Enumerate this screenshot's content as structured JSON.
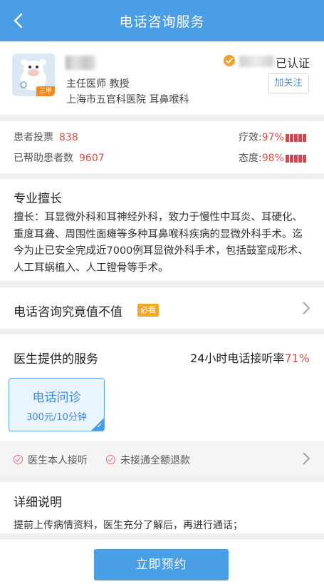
{
  "nav": {
    "title": "电话咨询服务"
  },
  "doctor": {
    "avatar_badge": "三甲",
    "title": "主任医师 教授",
    "hospital": "上海市五官科医院  耳鼻喉科",
    "verified_text": "已认证",
    "follow_label": "加关注"
  },
  "stats": {
    "votes_label": "患者投票",
    "votes": "838",
    "helped_label": "已帮助患者数",
    "helped": "9607",
    "efficacy_label": "疗效:",
    "efficacy": "97%",
    "attitude_label": "态度:",
    "attitude": "98%"
  },
  "expertise": {
    "title": "专业擅长",
    "text": "擅长：耳显微外科和耳神经外科，致力于慢性中耳炎、耳硬化、重度耳聋、周围性面瘫等多种耳鼻喉科疾病的显微外科手术。迄今为止已安全完成近7000例耳显微外科手术，包括鼓室成形术、人工耳蜗植入、人工镫骨等手术。"
  },
  "worth": {
    "label": "电话咨询究竟值不值",
    "badge": "必看"
  },
  "services": {
    "title": "医生提供的服务",
    "rate_label": "24小时电话接听率",
    "rate_value": "71%",
    "tile_name": "电话问诊",
    "tile_price": "300元/10分钟"
  },
  "guarantees": {
    "item1": "医生本人接听",
    "item2": "未接通全额退款"
  },
  "details": {
    "title": "详细说明",
    "text": "提前上传病情资料，医生充分了解后，再进行通话；"
  },
  "bottom": {
    "book_label": "立即预约"
  },
  "colors": {
    "primary": "#4a9ee6",
    "accent_red": "#e24a44",
    "badge_orange": "#f5a623"
  }
}
